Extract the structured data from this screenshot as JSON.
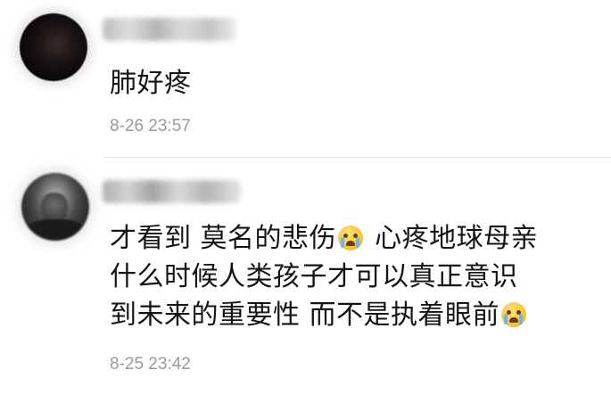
{
  "comments": [
    {
      "text_lines": [
        "肺好疼"
      ],
      "timestamp": "8-26 23:57"
    },
    {
      "line1_a": "才看到  莫名的悲伤",
      "line1_b": " 心疼地球母亲",
      "line2": "什么时候人类孩子才可以真正意识",
      "line3": "到未来的重要性 而不是执着眼前",
      "timestamp": "8-25 23:42",
      "emoji": "crying-face-icon"
    }
  ]
}
